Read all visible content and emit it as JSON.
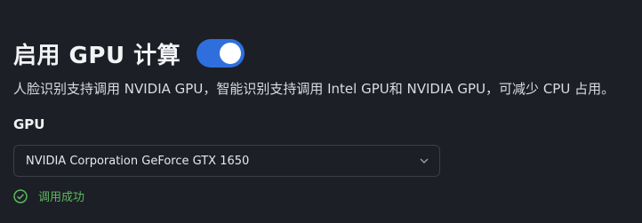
{
  "header": {
    "title": "启用 GPU 计算",
    "toggle_on": true
  },
  "description": "人脸识别支持调用 NVIDIA GPU，智能识别支持调用 Intel GPU和 NVIDIA GPU，可减少 CPU 占用。",
  "gpu": {
    "label": "GPU",
    "selected": "NVIDIA Corporation GeForce GTX 1650"
  },
  "status": {
    "text": "调用成功",
    "icon": "check-circle-icon"
  },
  "colors": {
    "accent": "#2e6fdd",
    "success": "#5cb85c",
    "background": "#1c1f26"
  }
}
